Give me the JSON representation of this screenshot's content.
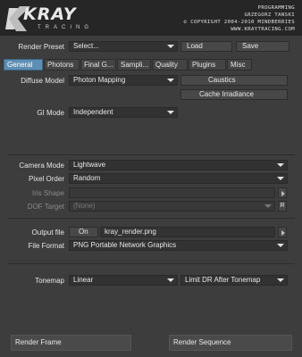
{
  "header": {
    "logo": "KRAY",
    "logo_sub": "TRACING",
    "info_lines": [
      "PROGRAMMING",
      "GRZEGORZ TANSKI",
      "© COPYRIGHT 2004-2010 MINDBERRIES",
      "WWW.KRAYTRACING.COM"
    ]
  },
  "preset": {
    "label": "Render Preset",
    "value": "Select...",
    "load_label": "Load",
    "save_label": "Save"
  },
  "tabs": [
    "General",
    "Photons",
    "Final G...",
    "Sampli...",
    "Quality",
    "Plugins",
    "Misc"
  ],
  "active_tab": "General",
  "general": {
    "diffuse_label": "Diffuse Model",
    "diffuse_value": "Photon Mapping",
    "caustics_label": "Caustics",
    "cache_irradiance_label": "Cache Irradiance",
    "gi_mode_label": "GI Mode",
    "gi_mode_value": "Independent",
    "camera_mode_label": "Camera Mode",
    "camera_mode_value": "Lightwave",
    "pixel_order_label": "Pixel Order",
    "pixel_order_value": "Random",
    "iris_shape_label": "Iris Shape",
    "iris_shape_value": "",
    "dof_target_label": "DOF Target",
    "dof_target_value": "(None)",
    "dof_r_label": "R",
    "output_file_label": "Output file",
    "output_on_label": "On",
    "output_file_value": "kray_render.png",
    "file_format_label": "File Format",
    "file_format_value": "PNG Portable Network Graphics",
    "tonemap_label": "Tonemap",
    "tonemap_value": "Linear",
    "limit_dr_value": "Limit DR After Tonemap"
  },
  "footer": {
    "render_frame_label": "Render Frame",
    "render_sequence_label": "Render Sequence"
  }
}
